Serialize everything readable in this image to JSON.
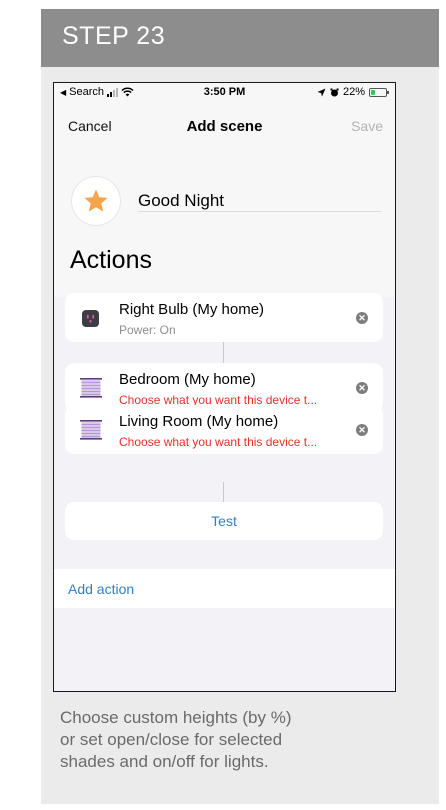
{
  "step": {
    "title": "STEP 23"
  },
  "status_bar": {
    "back_label": "Search",
    "time": "3:50 PM",
    "battery": "22%"
  },
  "nav": {
    "cancel": "Cancel",
    "title": "Add scene",
    "save": "Save"
  },
  "scene": {
    "name": "Good Night",
    "icon": "star-icon"
  },
  "actions": {
    "heading": "Actions",
    "items": [
      {
        "device": "Right Bulb (My home)",
        "status": "Power: On",
        "icon": "smart-plug-icon",
        "status_type": "normal"
      },
      {
        "device": "Bedroom (My home)",
        "status": "Choose what you want this device t...",
        "icon": "shade-icon",
        "status_type": "warning"
      },
      {
        "device": "Living Room (My home)",
        "status": "Choose what you want this device t...",
        "icon": "shade-icon",
        "status_type": "warning"
      }
    ],
    "test_label": "Test",
    "add_action": "Add action"
  },
  "caption": {
    "lines": [
      "Choose custom heights (by %)",
      "or set open/close  for selected",
      "shades and on/off for lights."
    ]
  },
  "colors": {
    "header_bg": "#8d8d8d",
    "card_bg": "#ebebeb",
    "link_blue": "#2f7fc1",
    "warning_red": "#e0322c",
    "star_orange": "#f6a54a"
  }
}
